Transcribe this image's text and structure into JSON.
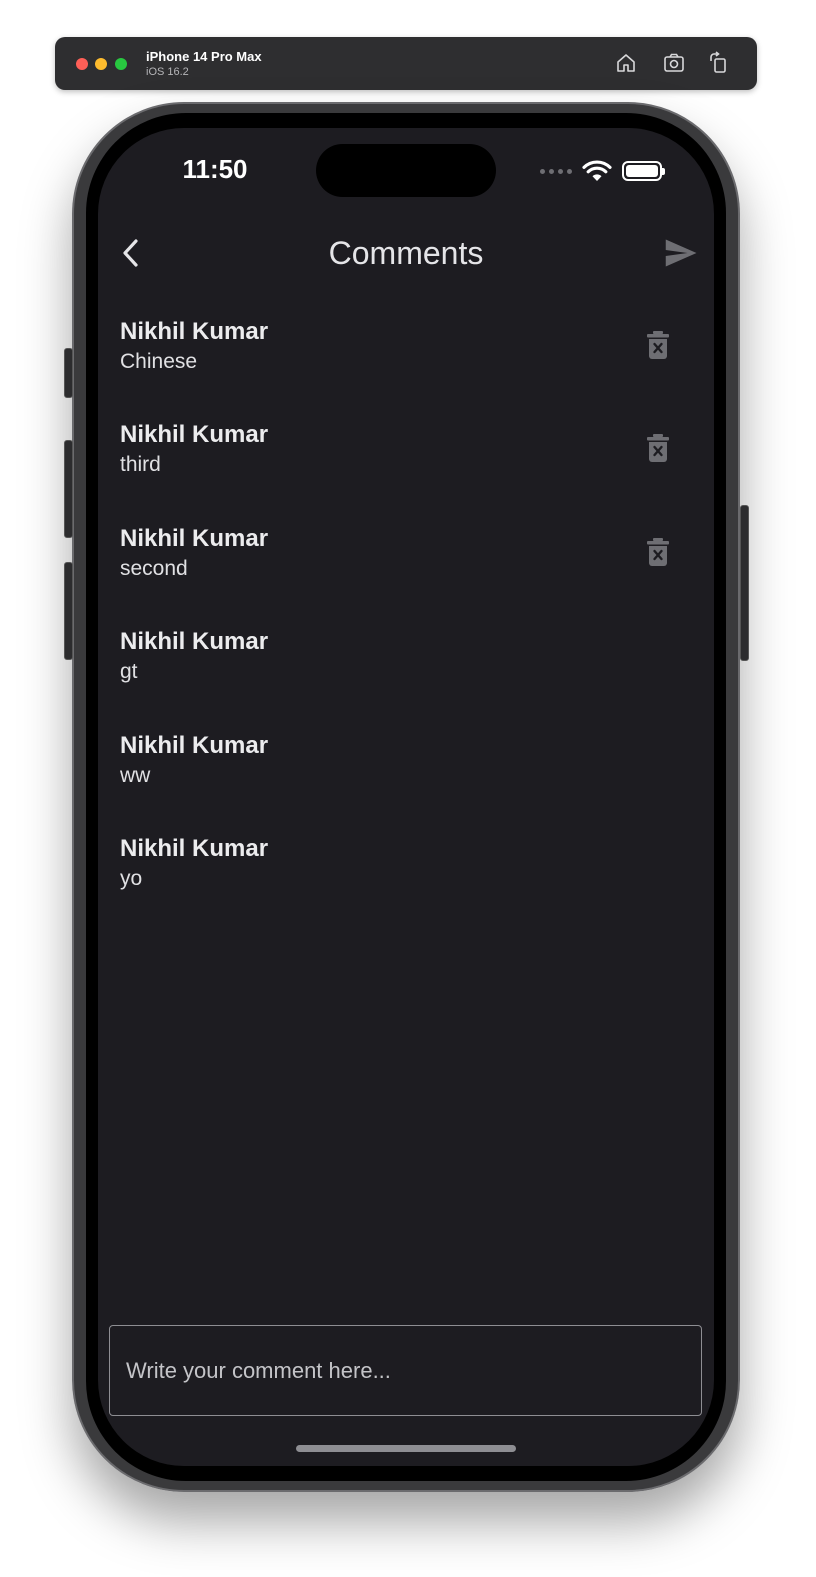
{
  "simulator": {
    "device_name": "iPhone 14 Pro Max",
    "os_version": "iOS 16.2",
    "icons": [
      "home-icon",
      "screenshot-icon",
      "rotate-icon"
    ]
  },
  "status_bar": {
    "time": "11:50"
  },
  "app_bar": {
    "title": "Comments",
    "back_icon": "chevron-left-icon",
    "send_icon": "send-icon"
  },
  "comments": [
    {
      "author": "Nikhil Kumar",
      "text": "Chinese",
      "deletable": true
    },
    {
      "author": "Nikhil Kumar",
      "text": "third",
      "deletable": true
    },
    {
      "author": "Nikhil Kumar",
      "text": "second",
      "deletable": true
    },
    {
      "author": "Nikhil Kumar",
      "text": "gt",
      "deletable": false
    },
    {
      "author": "Nikhil Kumar",
      "text": "ww",
      "deletable": false
    },
    {
      "author": "Nikhil Kumar",
      "text": "yo",
      "deletable": false
    }
  ],
  "input": {
    "placeholder": "Write your comment here...",
    "value": ""
  },
  "colors": {
    "background": "#1d1c21",
    "text": "#ececee",
    "icon_muted": "#6e6e73"
  }
}
